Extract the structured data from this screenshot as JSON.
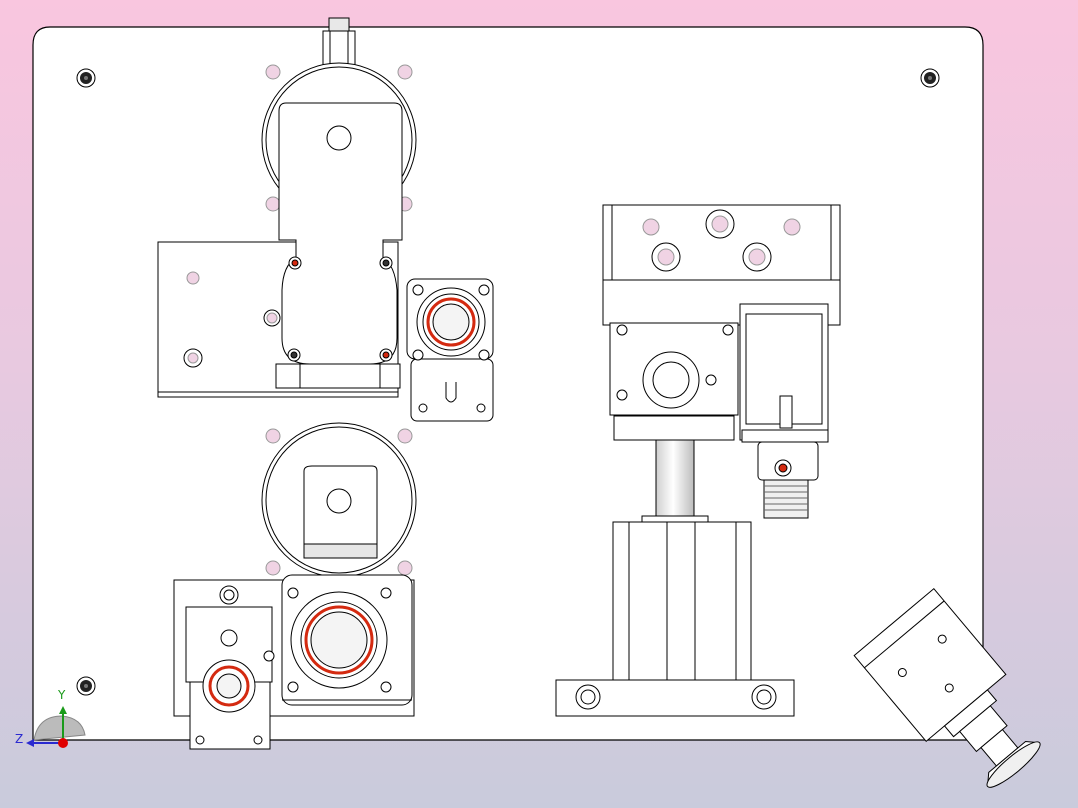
{
  "view": {
    "background_top": "#f9c6df",
    "background_bottom": "#c9cbdc",
    "line_color": "#000000",
    "hole_fill": "#f0d3e4",
    "seal_color": "#d42a10"
  },
  "triad": {
    "y_label": "Y",
    "z_label": "Z",
    "y_color": "#1a9a1a",
    "z_color": "#2a2ad0",
    "origin_color": "#e00000"
  }
}
